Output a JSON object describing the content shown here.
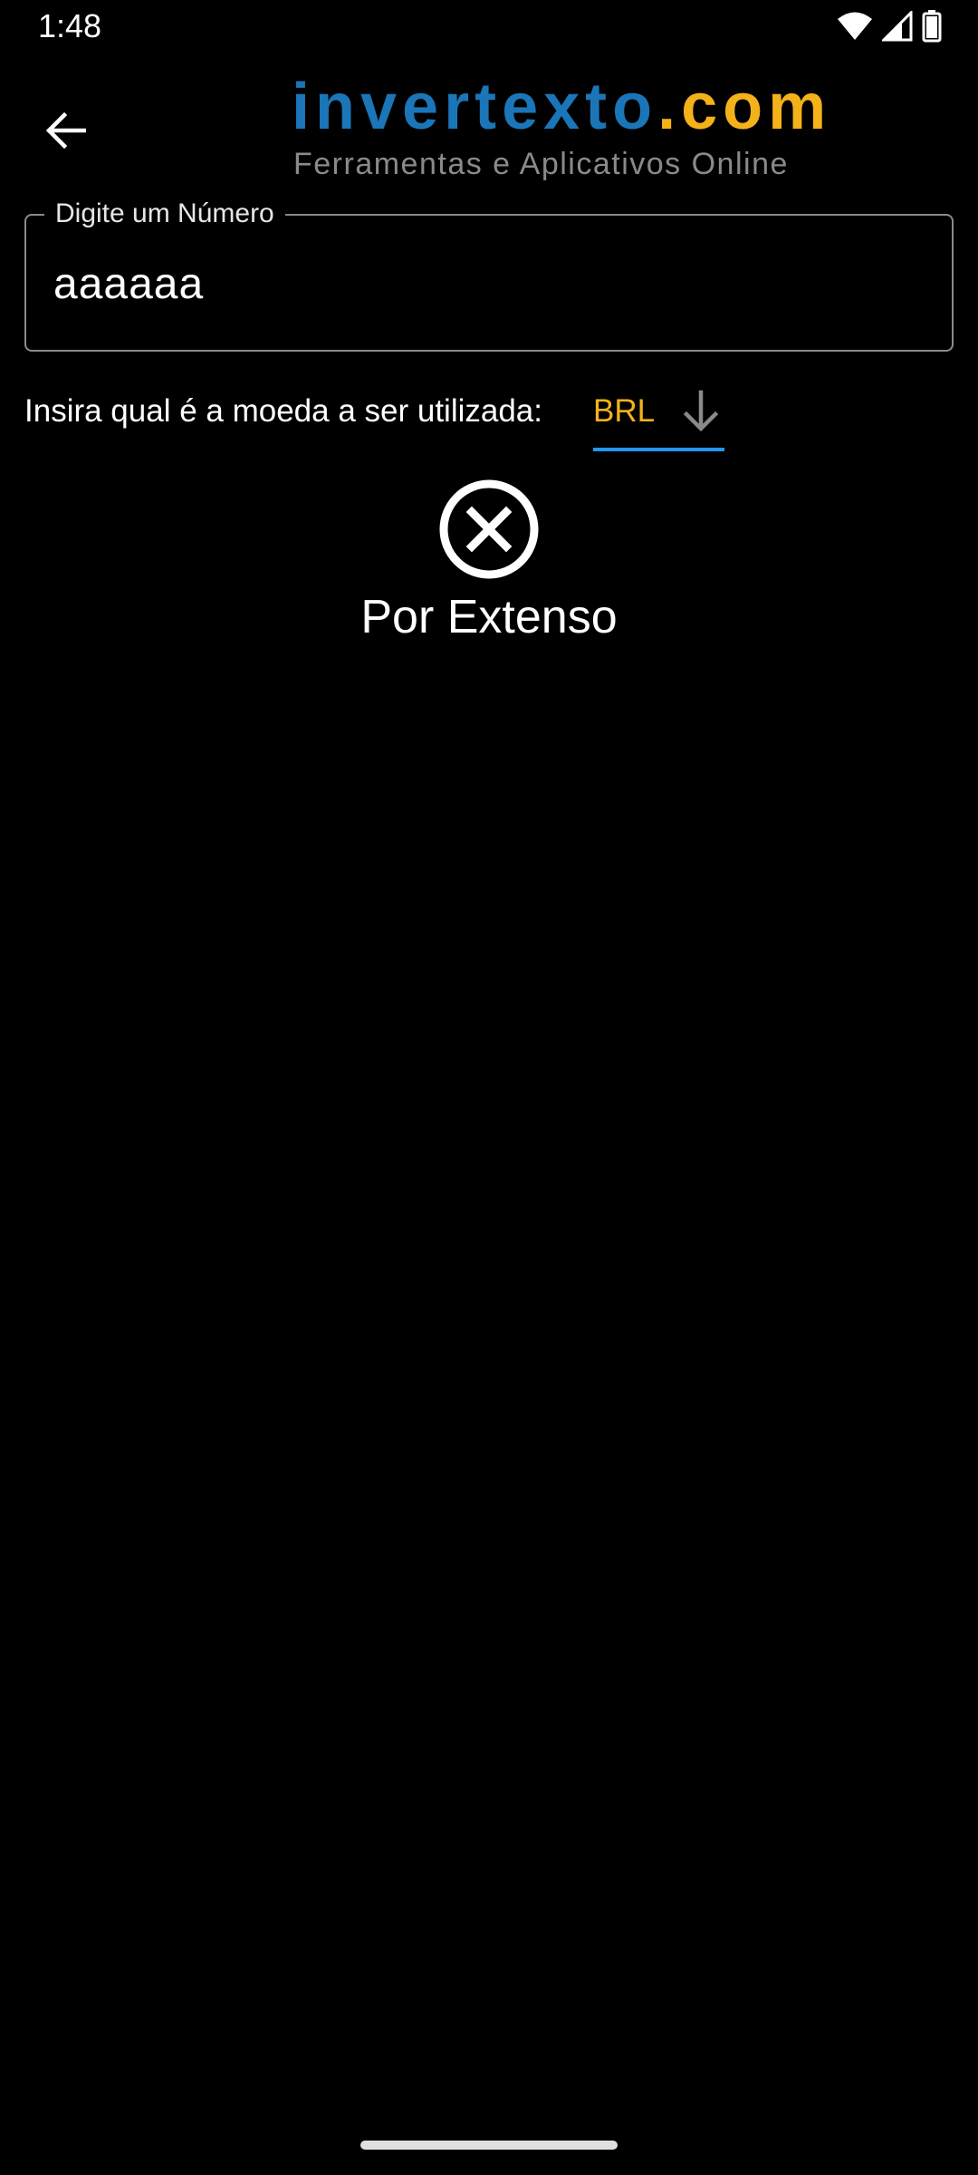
{
  "status_bar": {
    "time": "1:48",
    "icons": [
      "wifi-icon",
      "signal-icon",
      "battery-icon"
    ]
  },
  "app_bar": {
    "back_icon": "arrow-left-icon",
    "logo": {
      "brand_part1": "invertexto",
      "brand_part2": ".com",
      "tagline": "Ferramentas e Aplicativos Online",
      "colors": {
        "blue": "#1a76b8",
        "gold": "#f4b21a",
        "tagline": "#8a8a8a"
      }
    }
  },
  "number_field": {
    "label": "Digite um Número",
    "value": "aaaaaa"
  },
  "currency": {
    "prompt": "Insira qual é a moeda a ser utilizada:",
    "selected": "BRL",
    "icon": "arrow-down-icon",
    "colors": {
      "value": "#f4b21a",
      "underline": "#2196f3"
    }
  },
  "result": {
    "icon": "close-circle-icon",
    "title": "Por Extenso"
  }
}
